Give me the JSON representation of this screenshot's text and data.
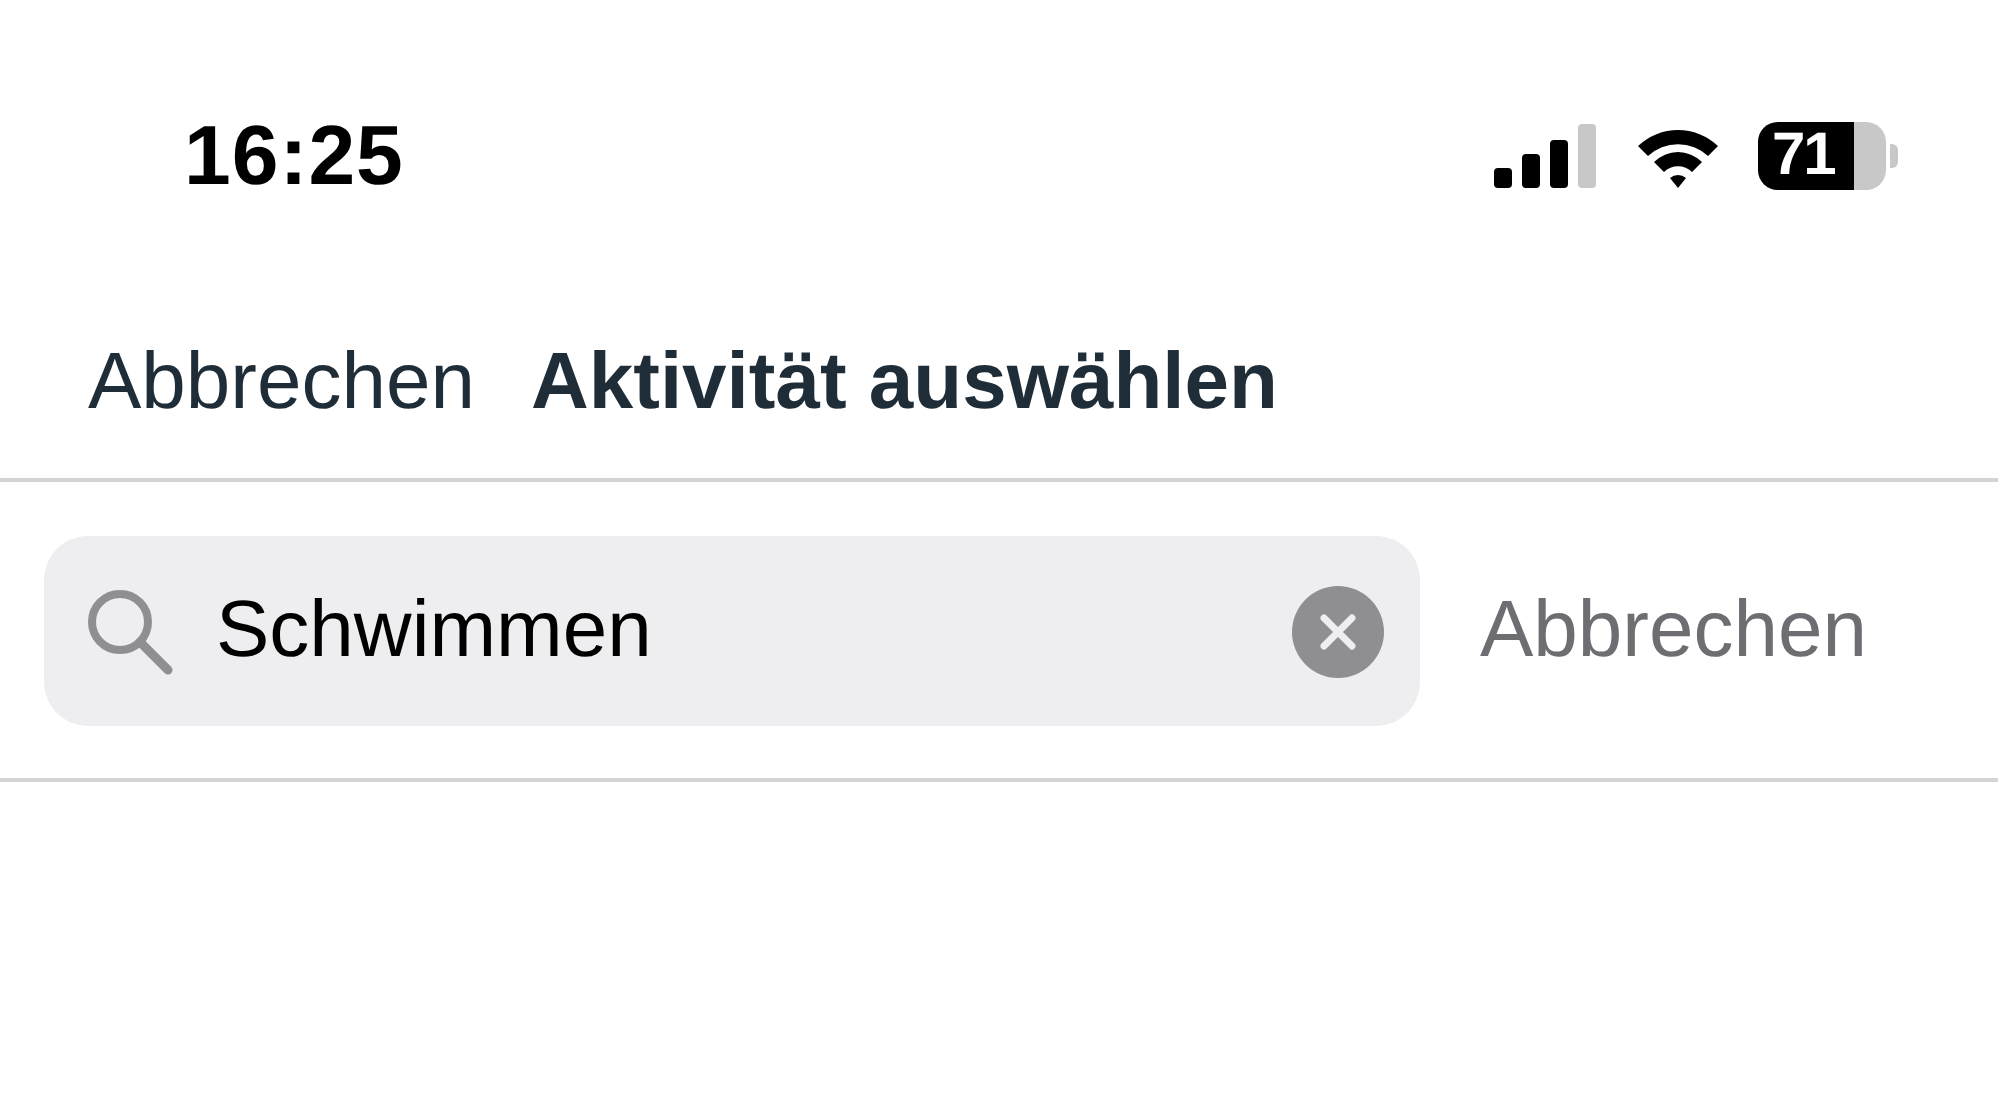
{
  "status_bar": {
    "time": "16:25",
    "battery": "71"
  },
  "nav": {
    "cancel": "Abbrechen",
    "title": "Aktivität auswählen"
  },
  "search": {
    "value": "Schwimmen",
    "cancel": "Abbrechen"
  }
}
